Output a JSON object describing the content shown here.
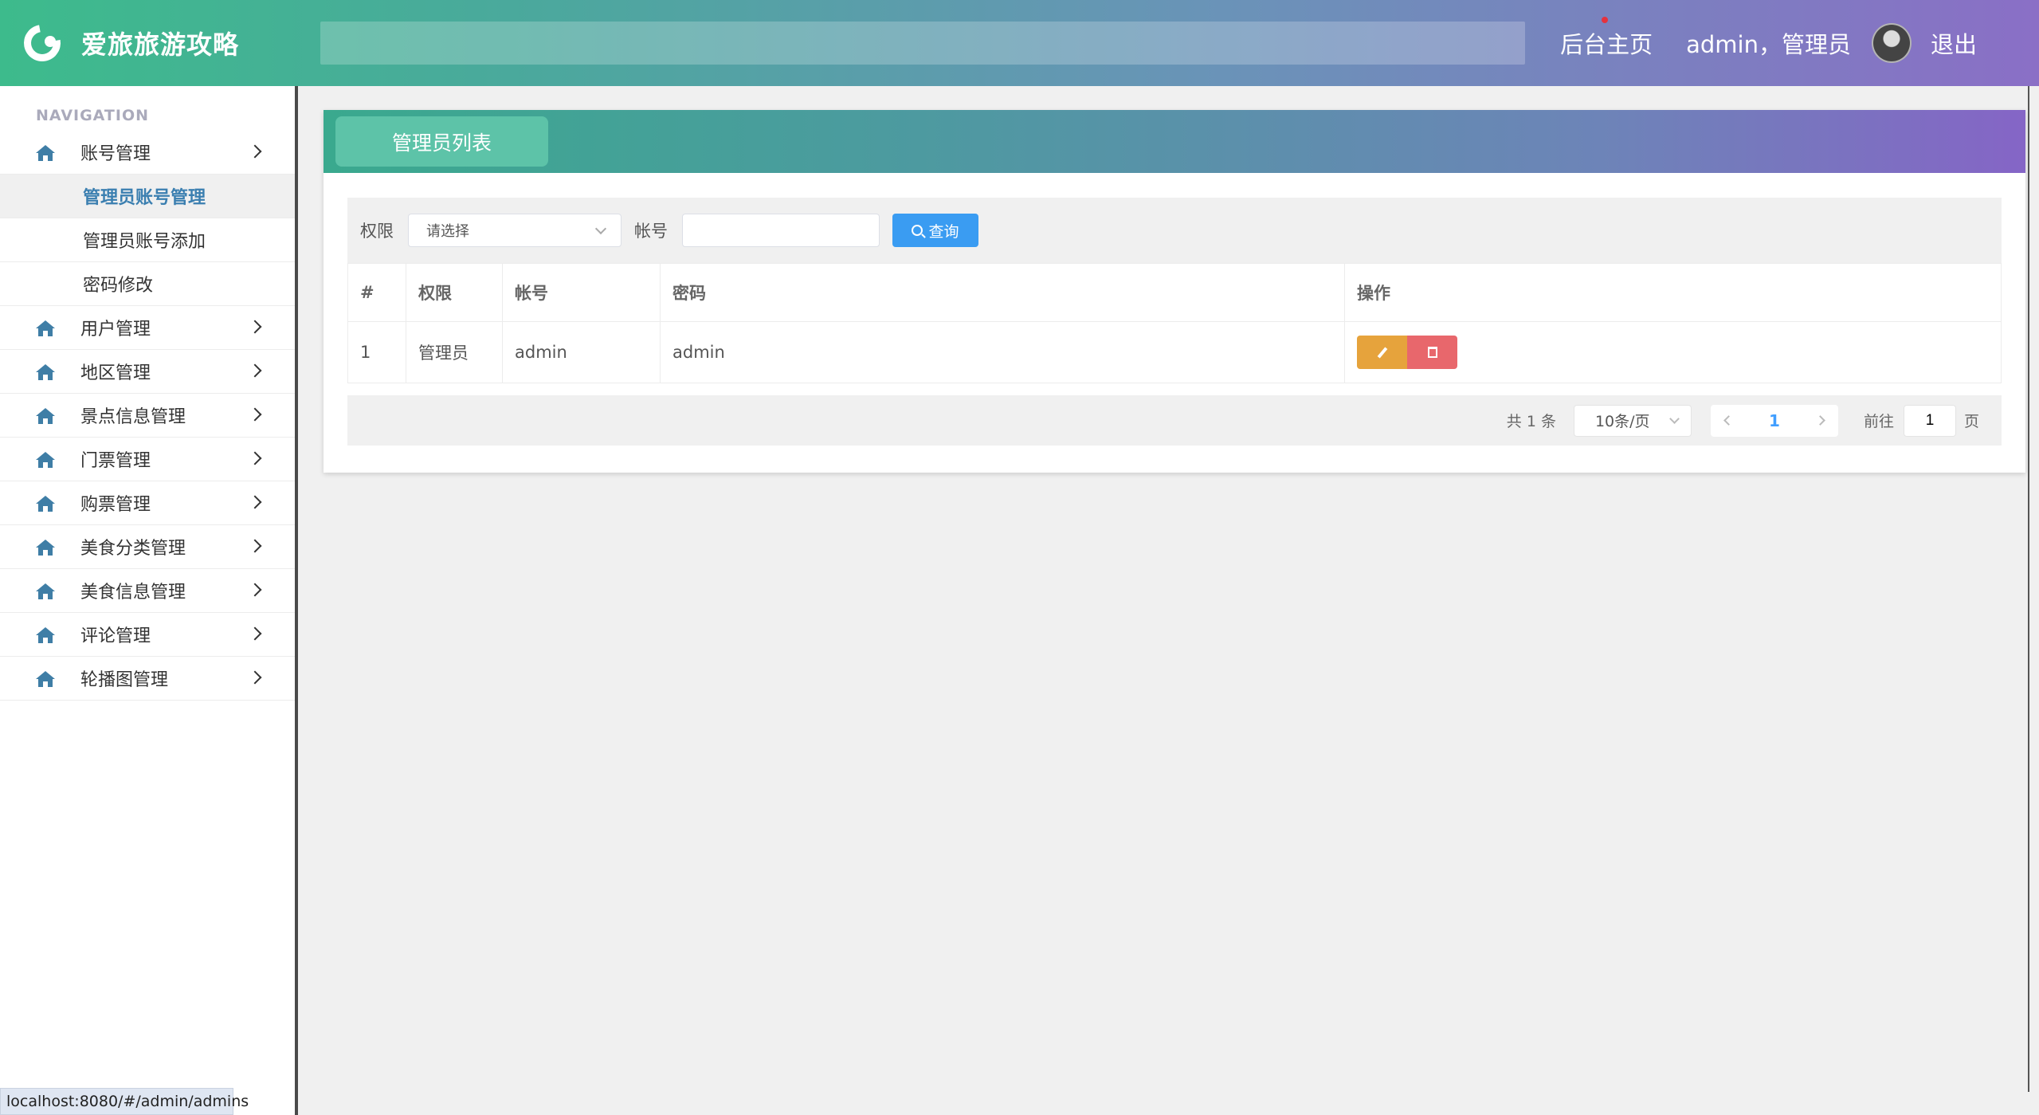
{
  "header": {
    "app_title": "爱旅旅游攻略",
    "home_link": "后台主页",
    "user": "admin，管理员",
    "logout": "退出"
  },
  "sidebar": {
    "nav_title": "NAVIGATION",
    "items": [
      {
        "label": "账号管理",
        "icon": "home-icon",
        "expanded": true,
        "children": [
          "管理员账号管理",
          "管理员账号添加",
          "密码修改"
        ]
      },
      {
        "label": "用户管理",
        "icon": "home-icon"
      },
      {
        "label": "地区管理",
        "icon": "home-icon"
      },
      {
        "label": "景点信息管理",
        "icon": "home-icon"
      },
      {
        "label": "门票管理",
        "icon": "home-icon"
      },
      {
        "label": "购票管理",
        "icon": "home-icon"
      },
      {
        "label": "美食分类管理",
        "icon": "home-icon"
      },
      {
        "label": "美食信息管理",
        "icon": "home-icon"
      },
      {
        "label": "评论管理",
        "icon": "home-icon"
      },
      {
        "label": "轮播图管理",
        "icon": "home-icon"
      }
    ],
    "active_child": "管理员账号管理"
  },
  "panel": {
    "title": "管理员列表",
    "filter": {
      "role_label": "权限",
      "role_placeholder": "请选择",
      "account_label": "帐号",
      "account_value": "",
      "query_button": "查询"
    },
    "table": {
      "columns": [
        "#",
        "权限",
        "帐号",
        "密码",
        "操作"
      ],
      "rows": [
        {
          "index": "1",
          "role": "管理员",
          "account": "admin",
          "password": "admin"
        }
      ]
    },
    "pagination": {
      "total": "共 1 条",
      "page_size": "10条/页",
      "current_page": "1",
      "goto_label": "前往",
      "goto_value": "1",
      "goto_unit": "页"
    }
  },
  "status_bar": {
    "url": "localhost:8080/#/admin/admins"
  },
  "colors": {
    "accent_green": "#3dbb8c",
    "accent_purple": "#8565c6",
    "primary_blue": "#3a9cf2",
    "edit_orange": "#e6a33c",
    "delete_red": "#e8676c",
    "active_menu_text": "#3b7fb0"
  }
}
